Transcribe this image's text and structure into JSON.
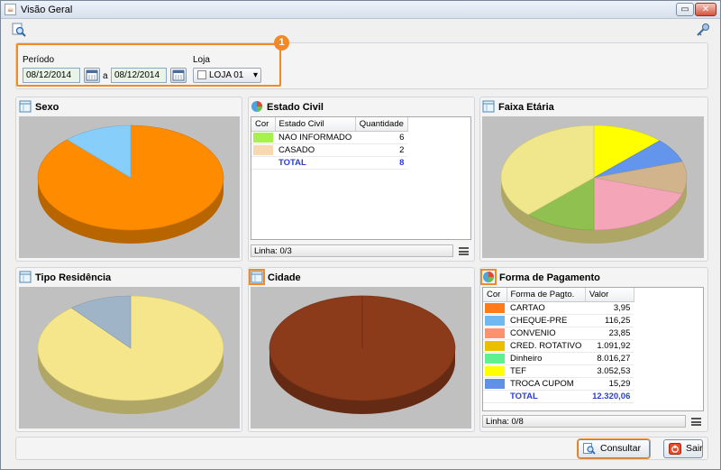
{
  "window": {
    "title": "Visão Geral"
  },
  "filters": {
    "period_label": "Período",
    "date_from": "08/12/2014",
    "separator": "a",
    "date_to": "08/12/2014",
    "store_label": "Loja",
    "store_value": "LOJA 01",
    "annotation": "1"
  },
  "sections": {
    "sexo": "Sexo",
    "estado_civil": "Estado Civil",
    "faixa_etaria": "Faixa Etária",
    "tipo_residencia": "Tipo Residência",
    "cidade": "Cidade",
    "forma_pagamento": "Forma de Pagamento"
  },
  "estado_civil_grid": {
    "headers": [
      "Cor",
      "Estado Civil",
      "Quantidade"
    ],
    "rows": [
      {
        "color": "#a8f04c",
        "label": "NAO INFORMADO",
        "value": "6"
      },
      {
        "color": "#f7d8b0",
        "label": "CASADO",
        "value": "2"
      }
    ],
    "total": {
      "color": "#ffffff",
      "label": "TOTAL",
      "value": "8"
    },
    "status": "Linha: 0/3"
  },
  "pagamento_grid": {
    "headers": [
      "Cor",
      "Forma de Pagto.",
      "Valor"
    ],
    "rows": [
      {
        "color": "#ff7a1a",
        "label": "CARTAO",
        "value": "3,95"
      },
      {
        "color": "#70b8f0",
        "label": "CHEQUE-PRE",
        "value": "116,25"
      },
      {
        "color": "#ff9070",
        "label": "CONVENIO",
        "value": "23,85"
      },
      {
        "color": "#e8c000",
        "label": "CRED. ROTATIVO",
        "value": "1.091,92"
      },
      {
        "color": "#60f090",
        "label": "Dinheiro",
        "value": "8.016,27"
      },
      {
        "color": "#ffff00",
        "label": "TEF",
        "value": "3.052,53"
      },
      {
        "color": "#6090e8",
        "label": "TROCA CUPOM",
        "value": "15,29"
      }
    ],
    "total": {
      "color": "#ffffff",
      "label": "TOTAL",
      "value": "12.320,06"
    },
    "status": "Linha: 0/8"
  },
  "buttons": {
    "consultar": "Consultar",
    "sair": "Sair"
  },
  "colors": {
    "accent": "#f08a24",
    "total_text": "#2a3fd0"
  },
  "chart_data": [
    {
      "type": "pie",
      "title": "Sexo",
      "series": [
        {
          "values": [
            88,
            12
          ],
          "colors": [
            "#ff8c00",
            "#87cefa"
          ]
        }
      ]
    },
    {
      "type": "pie",
      "title": "Faixa Etária",
      "series": [
        {
          "values": [
            12.5,
            7.5,
            10,
            20,
            12.5,
            37.5
          ],
          "colors": [
            "#ffff00",
            "#6495ed",
            "#d2b48c",
            "#f4a6b8",
            "#90c050",
            "#f0e68c"
          ]
        }
      ]
    },
    {
      "type": "pie",
      "title": "Tipo Residência",
      "series": [
        {
          "values": [
            89,
            11
          ],
          "colors": [
            "#f5e68c",
            "#a0b4c8"
          ]
        }
      ]
    },
    {
      "type": "pie",
      "title": "Cidade",
      "series": [
        {
          "values": [
            100
          ],
          "colors": [
            "#8b3a1a"
          ]
        }
      ]
    }
  ]
}
